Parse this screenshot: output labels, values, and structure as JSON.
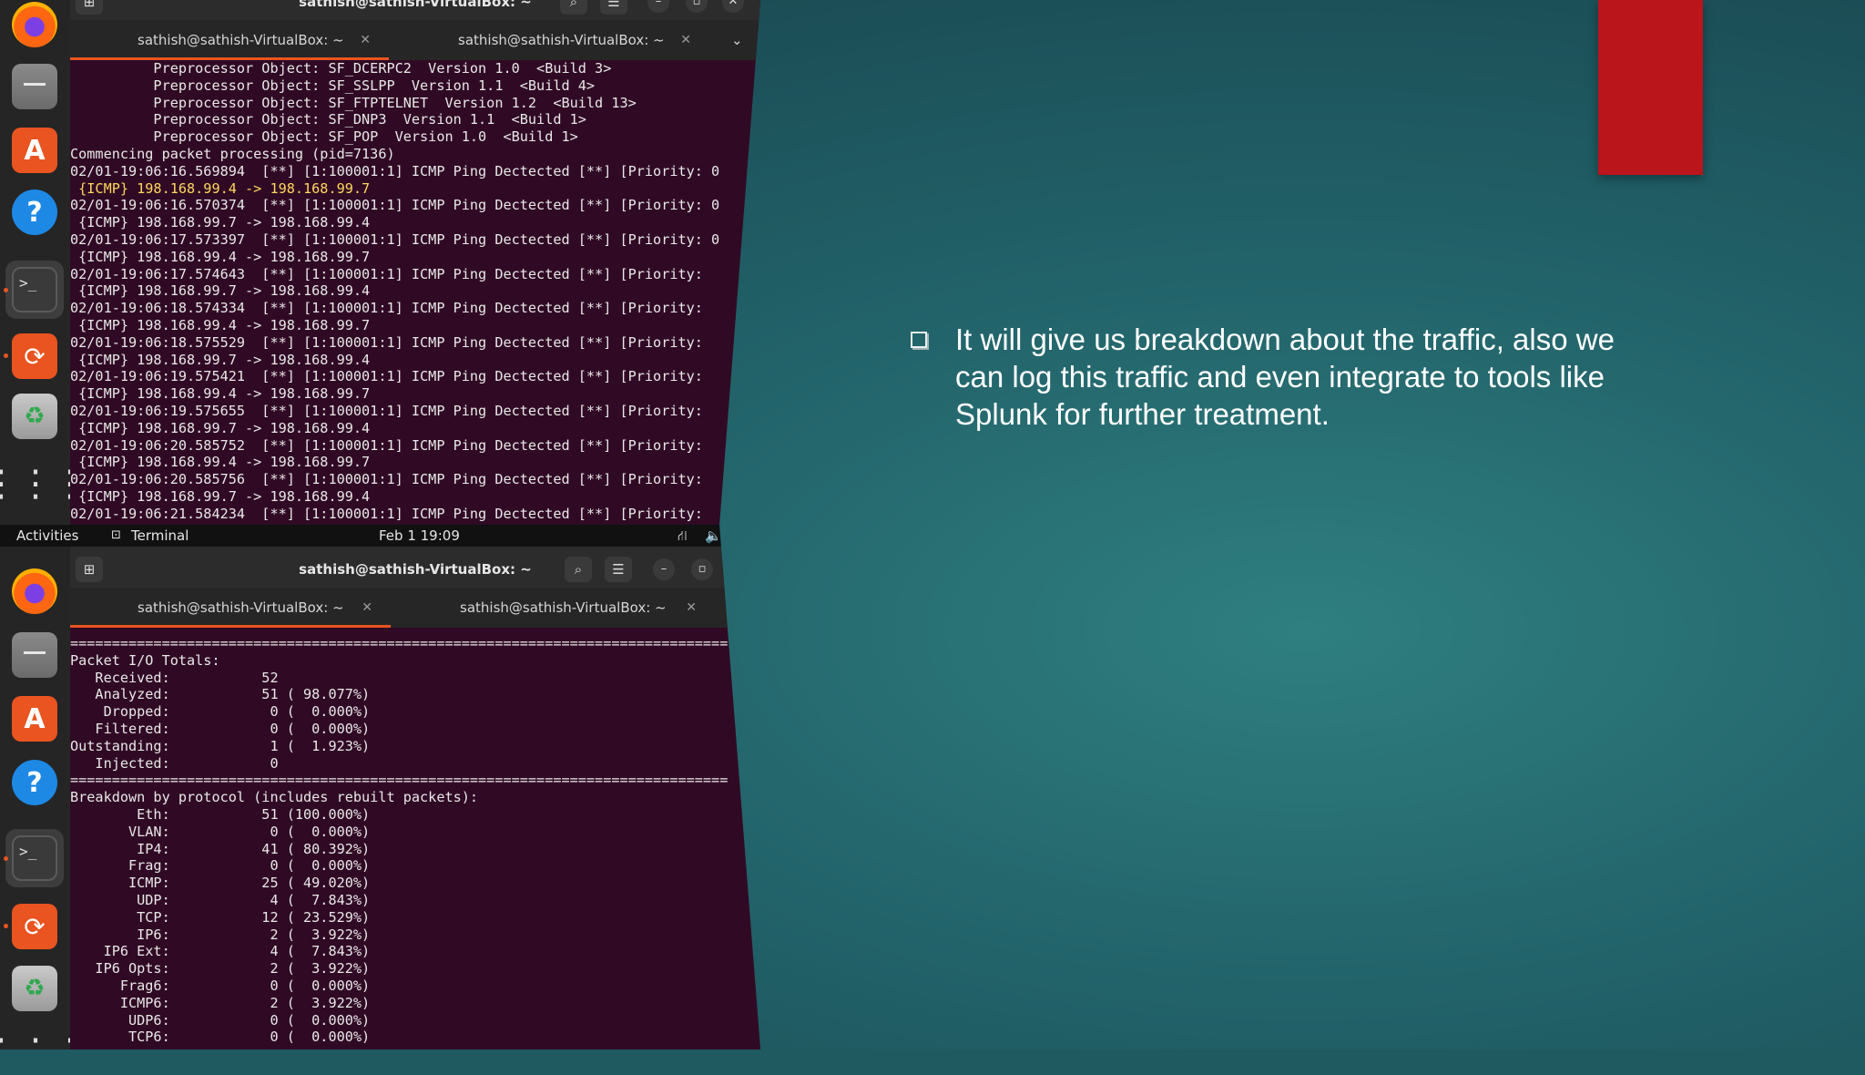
{
  "slide": {
    "bullet_text": "It will give us breakdown about the traffic, also we can log this traffic and even integrate to tools like Splunk for further treatment.",
    "accent_color": "#b9151b"
  },
  "top_terminal": {
    "title": "sathish@sathish-VirtualBox: ~",
    "tabs": [
      "sathish@sathish-VirtualBox: ~",
      "sathish@sathish-VirtualBox: ~"
    ],
    "lines": [
      "          Preprocessor Object: SF_DCERPC2  Version 1.0  <Build 3>",
      "          Preprocessor Object: SF_SSLPP  Version 1.1  <Build 4>",
      "          Preprocessor Object: SF_FTPTELNET  Version 1.2  <Build 13>",
      "          Preprocessor Object: SF_DNP3  Version 1.1  <Build 1>",
      "          Preprocessor Object: SF_POP  Version 1.0  <Build 1>",
      "Commencing packet processing (pid=7136)",
      "02/01-19:06:16.569894  [**] [1:100001:1] ICMP Ping Dectected [**] [Priority: 0",
      " {ICMP} 198.168.99.4 -> 198.168.99.7",
      "02/01-19:06:16.570374  [**] [1:100001:1] ICMP Ping Dectected [**] [Priority: 0",
      " {ICMP} 198.168.99.7 -> 198.168.99.4",
      "02/01-19:06:17.573397  [**] [1:100001:1] ICMP Ping Dectected [**] [Priority: 0",
      " {ICMP} 198.168.99.4 -> 198.168.99.7",
      "02/01-19:06:17.574643  [**] [1:100001:1] ICMP Ping Dectected [**] [Priority:",
      " {ICMP} 198.168.99.7 -> 198.168.99.4",
      "02/01-19:06:18.574334  [**] [1:100001:1] ICMP Ping Dectected [**] [Priority:",
      " {ICMP} 198.168.99.4 -> 198.168.99.7",
      "02/01-19:06:18.575529  [**] [1:100001:1] ICMP Ping Dectected [**] [Priority:",
      " {ICMP} 198.168.99.7 -> 198.168.99.4",
      "02/01-19:06:19.575421  [**] [1:100001:1] ICMP Ping Dectected [**] [Priority:",
      " {ICMP} 198.168.99.4 -> 198.168.99.7",
      "02/01-19:06:19.575655  [**] [1:100001:1] ICMP Ping Dectected [**] [Priority:",
      " {ICMP} 198.168.99.7 -> 198.168.99.4",
      "02/01-19:06:20.585752  [**] [1:100001:1] ICMP Ping Dectected [**] [Priority:",
      " {ICMP} 198.168.99.4 -> 198.168.99.7",
      "02/01-19:06:20.585756  [**] [1:100001:1] ICMP Ping Dectected [**] [Priority:",
      " {ICMP} 198.168.99.7 -> 198.168.99.4",
      "02/01-19:06:21.584234  [**] [1:100001:1] ICMP Ping Dectected [**] [Priority:"
    ]
  },
  "topbar": {
    "activities": "Activities",
    "app": "Terminal",
    "clock": "Feb 1  19:09"
  },
  "bottom_terminal": {
    "title": "sathish@sathish-VirtualBox: ~",
    "tabs": [
      "sathish@sathish-VirtualBox: ~",
      "sathish@sathish-VirtualBox: ~"
    ],
    "lines": [
      "===============================================================================",
      "Packet I/O Totals:",
      "   Received:           52",
      "   Analyzed:           51 ( 98.077%)",
      "    Dropped:            0 (  0.000%)",
      "   Filtered:            0 (  0.000%)",
      "Outstanding:            1 (  1.923%)",
      "   Injected:            0",
      "===============================================================================",
      "Breakdown by protocol (includes rebuilt packets):",
      "        Eth:           51 (100.000%)",
      "       VLAN:            0 (  0.000%)",
      "        IP4:           41 ( 80.392%)",
      "       Frag:            0 (  0.000%)",
      "       ICMP:           25 ( 49.020%)",
      "        UDP:            4 (  7.843%)",
      "        TCP:           12 ( 23.529%)",
      "        IP6:            2 (  3.922%)",
      "    IP6 Ext:            4 (  7.843%)",
      "   IP6 Opts:            2 (  3.922%)",
      "      Frag6:            0 (  0.000%)",
      "      ICMP6:            2 (  3.922%)",
      "       UDP6:            0 (  0.000%)",
      "       TCP6:            0 (  0.000%)"
    ]
  }
}
